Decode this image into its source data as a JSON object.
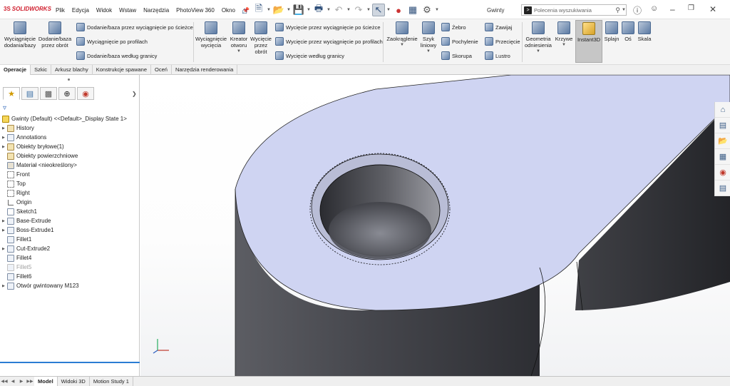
{
  "app": {
    "logo": "SOLIDWORKS",
    "logo_ds": "3S"
  },
  "menu": [
    "Plik",
    "Edycja",
    "Widok",
    "Wstaw",
    "Narzędzia",
    "PhotoView 360",
    "Okno"
  ],
  "document_title": "Gwinty",
  "search": {
    "placeholder": "Polecenia wyszukiwania"
  },
  "ribbon": {
    "big": [
      {
        "label": "Wyciągnięcie\ndodania/bazy"
      },
      {
        "label": "Dodanie/baza\nprzez obrót"
      },
      {
        "label": "Wyciągnięcie\nwycięcia"
      },
      {
        "label": "Kreator\notworu"
      },
      {
        "label": "Wycięcie\nprzez\nobrót"
      },
      {
        "label": "Zaokrąglenie"
      },
      {
        "label": "Szyk\nliniowy"
      },
      {
        "label": "Geometria\nodniesienia"
      },
      {
        "label": "Krzywe"
      },
      {
        "label": "Instant3D"
      },
      {
        "label": "Splajn"
      },
      {
        "label": "Oś"
      },
      {
        "label": "Skala"
      }
    ],
    "small": [
      {
        "label": "Dodanie/baza przez wyciągnięcie po ścieżce"
      },
      {
        "label": "Wyciągnięcie po profilach"
      },
      {
        "label": "Dodanie/baza według granicy"
      },
      {
        "label": "Wycięcie przez wyciągnięcie po ścieżce"
      },
      {
        "label": "Wycięcie przez wyciągnięcie po profilach"
      },
      {
        "label": "Wycięcie według granicy"
      },
      {
        "label": "Żebro"
      },
      {
        "label": "Pochylenie"
      },
      {
        "label": "Skorupa"
      },
      {
        "label": "Zawijaj"
      },
      {
        "label": "Przecięcie"
      },
      {
        "label": "Lustro"
      }
    ]
  },
  "command_tabs": [
    "Operacje",
    "Szkic",
    "Arkusz blachy",
    "Konstrukcje spawane",
    "Oceń",
    "Narzędzia renderowania"
  ],
  "tree": {
    "root": "Gwinty (Default) <<Default>_Display State 1>",
    "items": [
      {
        "label": "History"
      },
      {
        "label": "Annotations"
      },
      {
        "label": "Obiekty bryłowe(1)"
      },
      {
        "label": "Obiekty powierzchniowe"
      },
      {
        "label": "Materiał <nieokreślony>"
      },
      {
        "label": "Front"
      },
      {
        "label": "Top"
      },
      {
        "label": "Right"
      },
      {
        "label": "Origin"
      },
      {
        "label": "Sketch1"
      },
      {
        "label": "Base-Extrude"
      },
      {
        "label": "Boss-Extrude1"
      },
      {
        "label": "Fillet1"
      },
      {
        "label": "Cut-Extrude2"
      },
      {
        "label": "Fillet4"
      },
      {
        "label": "Fillet5"
      },
      {
        "label": "Fillet6"
      },
      {
        "label": "Otwór gwintowany M123"
      }
    ]
  },
  "bottom_tabs": [
    "Model",
    "Widoki 3D",
    "Motion Study 1"
  ],
  "colors": {
    "accent": "#2a7dd3",
    "part_top": "#cfd4f2",
    "part_side": "#3a3a40",
    "ribbon_bg": "#f4f4f4",
    "brand": "#d0202f"
  }
}
